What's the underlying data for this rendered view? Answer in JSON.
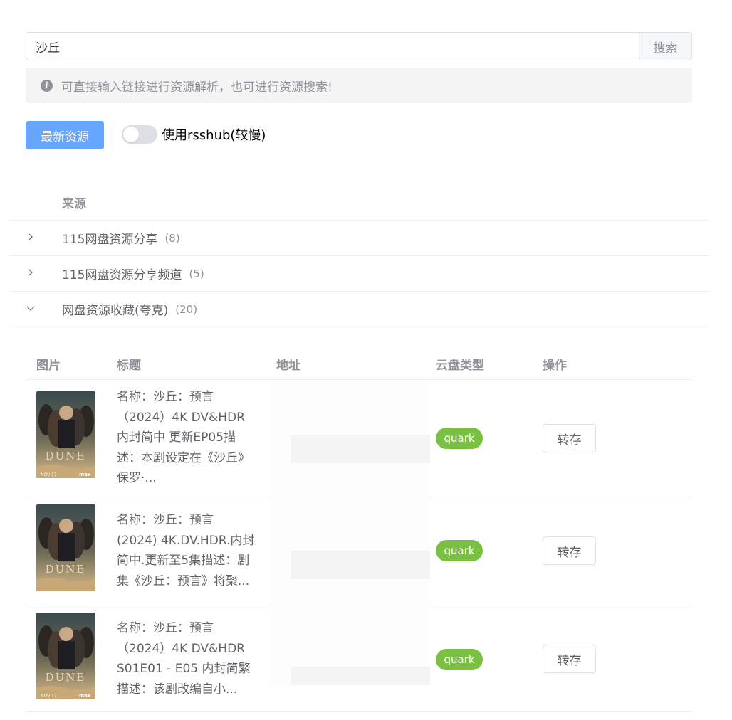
{
  "search": {
    "value": "沙丘",
    "button_label": "搜索"
  },
  "alert": {
    "icon": "info-icon",
    "text": "可直接输入链接进行资源解析，也可进行资源搜索!"
  },
  "actions": {
    "latest_button": "最新资源",
    "rsshub_toggle_label": "使用rsshub(较慢)",
    "rsshub_enabled": false
  },
  "outer_table": {
    "header_source": "来源",
    "groups": [
      {
        "name": "115网盘资源分享",
        "count": "(8)",
        "expanded": false
      },
      {
        "name": "115网盘资源分享频道",
        "count": "(5)",
        "expanded": false
      },
      {
        "name": "网盘资源收藏(夸克)",
        "count": "(20)",
        "expanded": true
      }
    ]
  },
  "inner_table": {
    "headers": {
      "image": "图片",
      "title": "标题",
      "address": "地址",
      "cloud_type": "云盘类型",
      "action": "操作"
    },
    "rows": [
      {
        "title_lines": [
          "名称：沙丘：预言",
          "（2024）4K DV&HDR",
          "内封简中 更新EP05描",
          "述：本剧设定在《沙丘》",
          "保罗·..."
        ],
        "cloud_type": "quark",
        "action": "转存"
      },
      {
        "title_lines": [
          "名称：沙丘：预言",
          "(2024) 4K.DV.HDR.内封",
          "简中.更新至5集描述：剧",
          "集《沙丘：预言》将聚..."
        ],
        "cloud_type": "quark",
        "action": "转存"
      },
      {
        "title_lines": [
          "名称：沙丘：预言",
          "（2024）4K DV&HDR",
          "S01E01 - E05 内封简繁",
          "描述：该剧改编自小..."
        ],
        "cloud_type": "quark",
        "action": "转存"
      }
    ]
  },
  "colors": {
    "primary": "#66a6ff",
    "quark_tag": "#7bc043",
    "muted_text": "#909399",
    "border": "#ebeef5"
  }
}
